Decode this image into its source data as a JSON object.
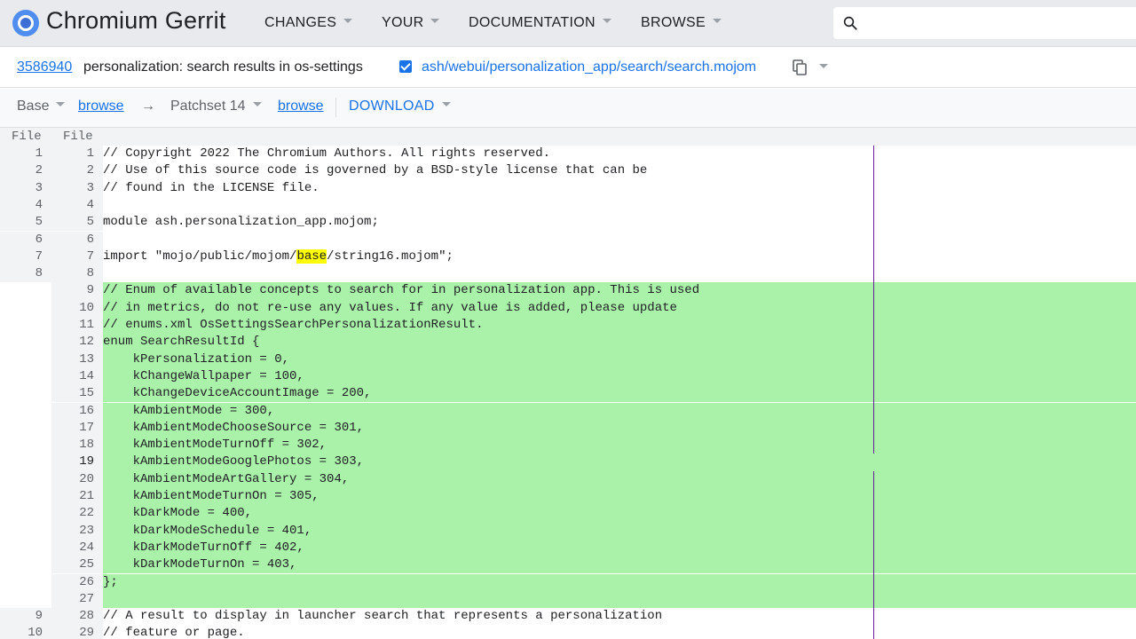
{
  "header": {
    "app_title": "Chromium Gerrit",
    "nav": [
      "CHANGES",
      "YOUR",
      "DOCUMENTATION",
      "BROWSE"
    ],
    "search_placeholder": ""
  },
  "change": {
    "number": "3586940",
    "subject": "personalization: search results in os-settings",
    "reviewed_checked": true,
    "file_path": "ash/webui/personalization_app/search/search.mojom"
  },
  "patchbar": {
    "base": "Base",
    "browse_base": "browse",
    "arrow": "→",
    "patchset": "Patchset 14",
    "browse_patch": "browse",
    "download": "DOWNLOAD"
  },
  "diff": {
    "header_left": "File",
    "header_right": "File",
    "lines": [
      {
        "l": "1",
        "r": "1",
        "code": "// Copyright 2022 The Chromium Authors. All rights reserved.",
        "added": false
      },
      {
        "l": "2",
        "r": "2",
        "code": "// Use of this source code is governed by a BSD-style license that can be",
        "added": false
      },
      {
        "l": "3",
        "r": "3",
        "code": "// found in the LICENSE file.",
        "added": false
      },
      {
        "l": "4",
        "r": "4",
        "code": "",
        "added": false
      },
      {
        "l": "5",
        "r": "5",
        "code": "module ash.personalization_app.mojom;",
        "added": false
      },
      {
        "l": "6",
        "r": "6",
        "code": "",
        "added": false
      },
      {
        "l": "7",
        "r": "7",
        "code_pre": "import \"mojo/public/mojom/",
        "code_hl": "base",
        "code_post": "/string16.mojom\";",
        "added": false
      },
      {
        "l": "8",
        "r": "8",
        "code": "",
        "added": false
      },
      {
        "l": "",
        "r": "9",
        "code": "// Enum of available concepts to search for in personalization app. This is used",
        "added": true
      },
      {
        "l": "",
        "r": "10",
        "code": "// in metrics, do not re-use any values. If any value is added, please update",
        "added": true
      },
      {
        "l": "",
        "r": "11",
        "code": "// enums.xml OsSettingsSearchPersonalizationResult.",
        "added": true
      },
      {
        "l": "",
        "r": "12",
        "code": "enum SearchResultId {",
        "added": true
      },
      {
        "l": "",
        "r": "13",
        "code": "    kPersonalization = 0,",
        "added": true
      },
      {
        "l": "",
        "r": "14",
        "code": "    kChangeWallpaper = 100,",
        "added": true
      },
      {
        "l": "",
        "r": "15",
        "code": "    kChangeDeviceAccountImage = 200,",
        "added": true
      },
      {
        "l": "",
        "r": "16",
        "code": "    kAmbientMode = 300,",
        "added": true
      },
      {
        "l": "",
        "r": "17",
        "code": "    kAmbientModeChooseSource = 301,",
        "added": true
      },
      {
        "l": "",
        "r": "18",
        "code": "    kAmbientModeTurnOff = 302,",
        "added": true
      },
      {
        "l": "",
        "r": "19",
        "code": "    kAmbientModeGooglePhotos = 303,",
        "added": true,
        "selected": true
      },
      {
        "l": "",
        "r": "20",
        "code": "    kAmbientModeArtGallery = 304,",
        "added": true
      },
      {
        "l": "",
        "r": "21",
        "code": "    kAmbientModeTurnOn = 305,",
        "added": true
      },
      {
        "l": "",
        "r": "22",
        "code": "    kDarkMode = 400,",
        "added": true
      },
      {
        "l": "",
        "r": "23",
        "code": "    kDarkModeSchedule = 401,",
        "added": true
      },
      {
        "l": "",
        "r": "24",
        "code": "    kDarkModeTurnOff = 402,",
        "added": true
      },
      {
        "l": "",
        "r": "25",
        "code": "    kDarkModeTurnOn = 403,",
        "added": true
      },
      {
        "l": "",
        "r": "26",
        "code": "};",
        "added": true
      },
      {
        "l": "",
        "r": "27",
        "code": "",
        "added": true
      },
      {
        "l": "9",
        "r": "28",
        "code": "// A result to display in launcher search that represents a personalization",
        "added": false
      },
      {
        "l": "10",
        "r": "29",
        "code": "// feature or page.",
        "added": false
      }
    ]
  },
  "colors": {
    "added_bg": "#aaf2aa",
    "link": "#1a73e8",
    "column_guide": "#6a1b9a",
    "highlight": "#ffff00"
  }
}
